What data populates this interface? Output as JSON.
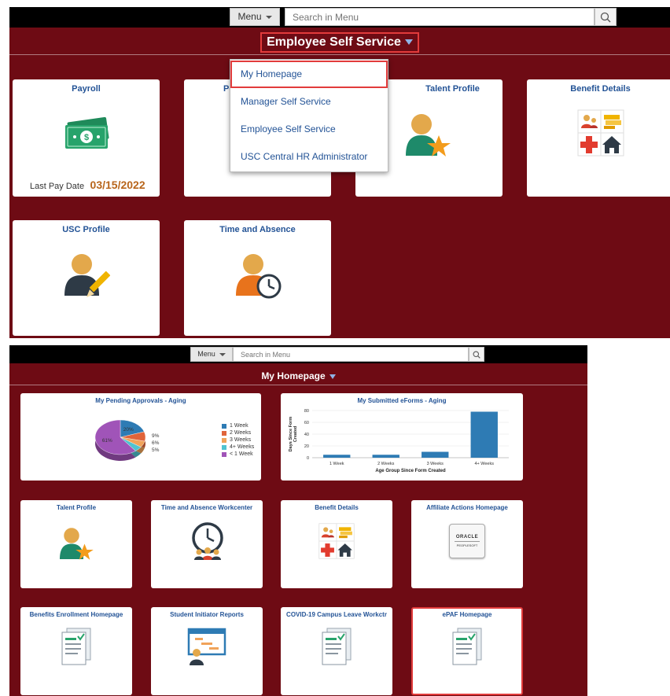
{
  "top": {
    "menu_label": "Menu",
    "search_placeholder": "Search in Menu",
    "page_title": "Employee Self Service",
    "dropdown": [
      "My Homepage",
      "Manager Self Service",
      "Employee Self Service",
      "USC Central HR Administrator"
    ],
    "tiles": {
      "payroll": {
        "title": "Payroll",
        "last_pay_label": "Last Pay Date",
        "last_pay_value": "03/15/2022"
      },
      "second": {
        "title_partial": "Pe"
      },
      "talent": {
        "title": "Talent Profile"
      },
      "benefits": {
        "title": "Benefit Details"
      },
      "usc_profile": {
        "title": "USC Profile"
      },
      "time_absence": {
        "title": "Time and Absence"
      }
    }
  },
  "bottom": {
    "menu_label": "Menu",
    "search_placeholder": "Search in Menu",
    "page_title": "My Homepage",
    "tiles": {
      "approvals": {
        "title": "My Pending Approvals - Aging"
      },
      "eforms": {
        "title": "My Submitted eForms - Aging"
      },
      "talent": {
        "title": "Talent Profile"
      },
      "time_wc": {
        "title": "Time and Absence Workcenter"
      },
      "benefits": {
        "title": "Benefit Details"
      },
      "affiliate": {
        "title": "Affiliate Actions Homepage",
        "logo_line1": "ORACLE",
        "logo_line2": "PEOPLESOFT"
      },
      "benefits_enroll": {
        "title": "Benefits Enrollment Homepage"
      },
      "student": {
        "title": "Student Initiator Reports"
      },
      "covid": {
        "title": "COVID-19 Campus Leave Workctr"
      },
      "epaf": {
        "title": "ePAF Homepage"
      }
    }
  },
  "chart_data": [
    {
      "type": "pie",
      "title": "My Pending Approvals - Aging",
      "labels": [
        "1 Week",
        "2 Weeks",
        "3 Weeks",
        "4+ Weeks",
        "< 1 Week"
      ],
      "values": [
        20,
        9,
        6,
        5,
        61
      ],
      "value_labels": [
        "20%",
        "9%",
        "6%",
        "5%",
        "61%"
      ],
      "colors": [
        "#2e7bb4",
        "#e0643a",
        "#f0a35a",
        "#4fc3d0",
        "#a054b8"
      ],
      "legend": "right"
    },
    {
      "type": "bar",
      "title": "My Submitted eForms - Aging",
      "categories": [
        "1 Week",
        "2 Weeks",
        "3 Weeks",
        "4+ Weeks"
      ],
      "values": [
        5,
        5,
        10,
        78
      ],
      "xlabel": "Age Group Since Form Created",
      "ylabel": "Days Since Form Created",
      "ylim": [
        0,
        80
      ],
      "yticks": [
        0,
        20,
        40,
        60,
        80
      ],
      "grid": true,
      "color": "#2e7bb4"
    }
  ],
  "colors": {
    "panel": "#6e0b14",
    "accent_blue": "#235396",
    "highlight_red": "#e23b3b",
    "pay_date_orange": "#b8651b"
  }
}
